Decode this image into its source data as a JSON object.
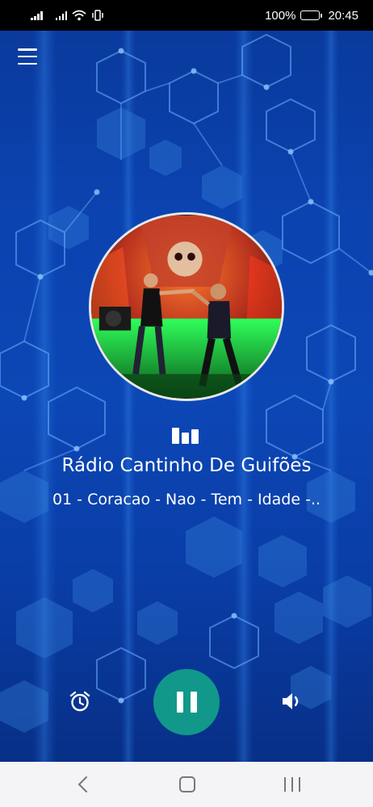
{
  "status_bar": {
    "battery_percent": "100%",
    "time": "20:45",
    "icons": [
      "signal-icon",
      "signal-icon",
      "wifi-icon",
      "vibrate-icon",
      "battery-icon"
    ]
  },
  "player": {
    "station_name": "Rádio Cantinho De Guifões",
    "song_title": "01 - Coracao - Nao - Tem - Idade -..",
    "is_playing": true
  },
  "controls": {
    "menu_icon": "hamburger-menu-icon",
    "alarm_icon": "alarm-clock-icon",
    "play_pause_icon": "pause-icon",
    "volume_icon": "speaker-volume-icon",
    "equalizer_icon": "equalizer-icon"
  },
  "nav_bar": {
    "icons": [
      "back-icon",
      "home-icon",
      "recents-icon"
    ]
  },
  "colors": {
    "background": "#0b43b0",
    "play_button": "#11988a",
    "text": "#ffffff",
    "nav_bar": "#f4f4f6"
  }
}
